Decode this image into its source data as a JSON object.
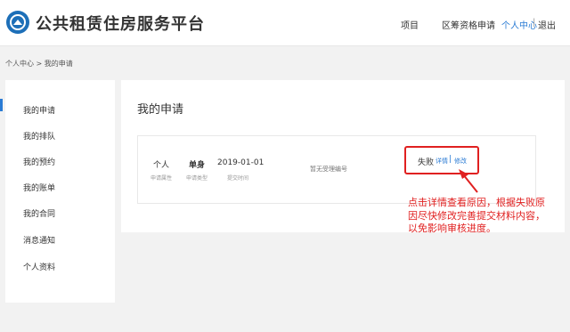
{
  "header": {
    "site_title": "公共租赁住房服务平台",
    "nav": [
      "项目",
      "区筹资格申请",
      "个人中心",
      "|",
      "退出"
    ]
  },
  "breadcrumb": "个人中心 > 我的申请",
  "sidebar": {
    "items": [
      {
        "label": "我的申请"
      },
      {
        "label": "我的排队"
      },
      {
        "label": "我的预约"
      },
      {
        "label": "我的账单"
      },
      {
        "label": "我的合同"
      },
      {
        "label": "消息通知"
      },
      {
        "label": "个人资料"
      }
    ]
  },
  "main": {
    "title": "我的申请",
    "application": {
      "attribute_value": "个人",
      "attribute_label": "申请属性",
      "type_value": "单身",
      "type_label": "申请类型",
      "date_value": "2019-01-01",
      "date_label": "提交时间",
      "receipt_no": "暂无受理编号",
      "status": "失败",
      "detail_link": "详情",
      "link_separator": "|",
      "edit_link": "修改"
    }
  },
  "annotation": "点击详情查看原因，根据失败原因尽快修改完善提交材料内容，以免影响审核进度。",
  "colors": {
    "accent": "#2a7bd4",
    "annotation_red": "#e02020",
    "background": "#f2f2f2"
  },
  "icons": {
    "logo": "housing-logo-icon"
  }
}
